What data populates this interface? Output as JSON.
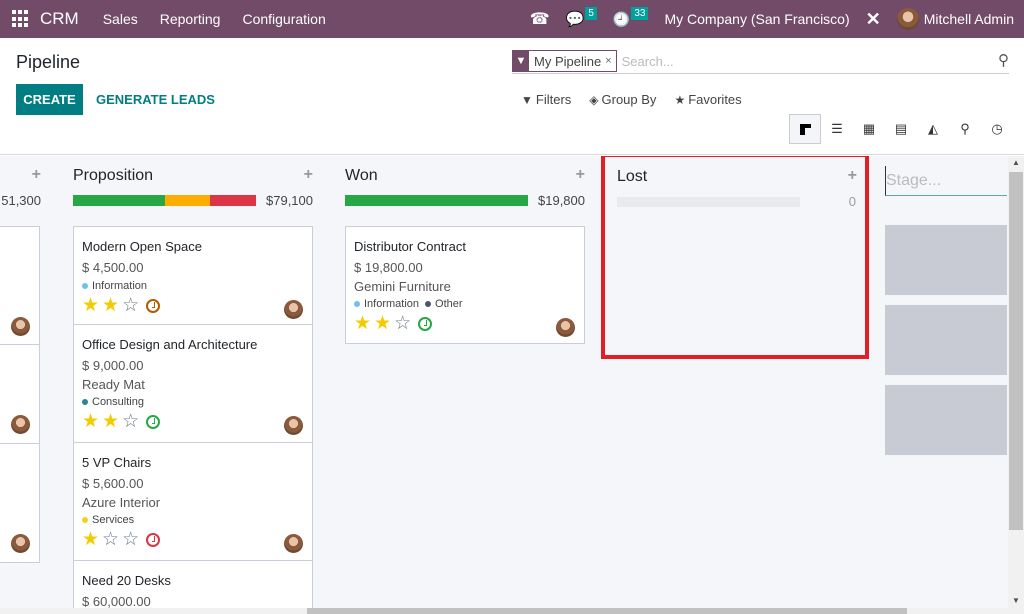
{
  "navbar": {
    "app_name": "CRM",
    "menu": [
      "Sales",
      "Reporting",
      "Configuration"
    ],
    "messages_count": "5",
    "activities_count": "33",
    "company": "My Company (San Francisco)",
    "user": "Mitchell Admin"
  },
  "control_panel": {
    "title": "Pipeline",
    "create_label": "CREATE",
    "generate_label": "GENERATE LEADS",
    "facet_label": "My Pipeline",
    "facet_remove": "×",
    "search_placeholder": "Search...",
    "filters_label": "Filters",
    "groupby_label": "Group By",
    "favorites_label": "Favorites",
    "views": [
      "kanban",
      "list",
      "calendar",
      "pivot",
      "graph",
      "map",
      "activity"
    ],
    "active_view": "kanban"
  },
  "kanban": {
    "partial_column": {
      "sum": "51,300"
    },
    "columns": [
      {
        "name": "Proposition",
        "sum": "$79,100",
        "progress": {
          "green": 0.5,
          "orange": 0.25,
          "red": 0.25
        },
        "cards": [
          {
            "name": "Modern Open Space",
            "amount": "$ 4,500.00",
            "company": "",
            "tags": [
              {
                "label": "Information",
                "color": "#6cc1ed"
              }
            ],
            "stars": 2,
            "activity": "planned",
            "activity_color": "#b05c00"
          },
          {
            "name": "Office Design and Architecture",
            "amount": "$ 9,000.00",
            "company": "Ready Mat",
            "tags": [
              {
                "label": "Consulting",
                "color": "#2c8397"
              }
            ],
            "stars": 2,
            "activity": "today",
            "activity_color": "#28a745"
          },
          {
            "name": "5 VP Chairs",
            "amount": "$ 5,600.00",
            "company": "Azure Interior",
            "tags": [
              {
                "label": "Services",
                "color": "#f7cd1f"
              }
            ],
            "stars": 1,
            "activity": "overdue",
            "activity_color": "#dc3545"
          },
          {
            "name": "Need 20 Desks",
            "amount": "$ 60,000.00",
            "company": "",
            "tags": [],
            "stars": 0,
            "activity": "",
            "activity_color": ""
          }
        ]
      },
      {
        "name": "Won",
        "sum": "$19,800",
        "progress": {
          "green": 1,
          "orange": 0,
          "red": 0
        },
        "cards": [
          {
            "name": "Distributor Contract",
            "amount": "$ 19,800.00",
            "company": "Gemini Furniture",
            "tags": [
              {
                "label": "Information",
                "color": "#6cc1ed"
              },
              {
                "label": "Other",
                "color": "#4c5470"
              }
            ],
            "stars": 2,
            "activity": "today",
            "activity_color": "#28a745"
          }
        ]
      },
      {
        "name": "Lost",
        "sum": "0",
        "cards": []
      }
    ],
    "new_stage_placeholder": "Stage..."
  }
}
